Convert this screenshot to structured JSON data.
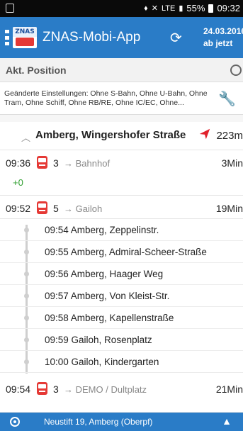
{
  "status_bar": {
    "battery": "55%",
    "time": "09:32",
    "network": "LTE"
  },
  "app_bar": {
    "logo_text": "ZNAS",
    "title": "ZNAS-Mobi-App",
    "date": "24.03.2016",
    "date_sub": "ab jetzt"
  },
  "position": {
    "label": "Akt. Position"
  },
  "settings": {
    "text": "Geänderte Einstellungen: Ohne S-Bahn, Ohne U-Bahn, Ohne Tram, Ohne Schiff, Ohne RB/RE, Ohne IC/EC, Ohne..."
  },
  "stop": {
    "name": "Amberg, Wingershofer Straße",
    "distance": "223m"
  },
  "departures": [
    {
      "time": "09:36",
      "line": "3",
      "destination": "Bahnhof",
      "minutes": "3Min",
      "delay": "+0"
    },
    {
      "time": "09:52",
      "line": "5",
      "destination": "Gailoh",
      "minutes": "19Min"
    },
    {
      "time": "09:54",
      "line": "3",
      "destination": "DEMO / Dultplatz",
      "minutes": "21Min"
    }
  ],
  "intermediate_stops": [
    "09:54 Amberg, Zeppelinstr.",
    "09:55 Amberg, Admiral-Scheer-Straße",
    "09:56 Amberg, Haager Weg",
    "09:57 Amberg, Von Kleist-Str.",
    "09:58 Amberg, Kapellenstraße",
    "09:59 Gailoh, Rosenplatz",
    "10:00 Gailoh, Kindergarten"
  ],
  "bottom_bar": {
    "address": "Neustift 19, Amberg (Oberpf)"
  },
  "colors": {
    "primary": "#2a7cc7",
    "bus_red": "#e53935",
    "delay_green": "#2e9e2e",
    "arrow_red": "#e0222c"
  },
  "icons": {
    "refresh": "refresh-icon",
    "target": "target-icon",
    "wrench": "wrench-icon",
    "bus": "bus-icon",
    "location": "location-icon",
    "expand": "chevron-up-icon"
  }
}
